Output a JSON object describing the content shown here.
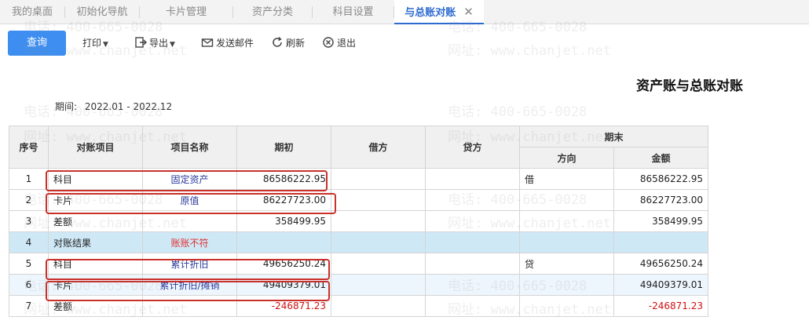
{
  "tabs": [
    {
      "label": "我的桌面"
    },
    {
      "label": "初始化导航"
    },
    {
      "label": "卡片管理"
    },
    {
      "label": "资产分类"
    },
    {
      "label": "科目设置"
    },
    {
      "label": "与总账对账"
    }
  ],
  "toolbar": {
    "query": "查询",
    "print": "打印",
    "export": "导出",
    "email": "发送邮件",
    "refresh": "刷新",
    "exit": "退出"
  },
  "report": {
    "title": "资产账与总账对账",
    "period_label": "期间:",
    "period_value": "2022.01 - 2022.12"
  },
  "table": {
    "headers": {
      "seq": "序号",
      "item": "对账项目",
      "name": "项目名称",
      "opening": "期初",
      "debit": "借方",
      "credit": "贷方",
      "ending": "期末",
      "direction": "方向",
      "amount": "金额"
    },
    "rows": [
      {
        "seq": "1",
        "item": "科目",
        "name": "固定资产",
        "opening": "86586222.95",
        "debit": "",
        "credit": "",
        "direction": "借",
        "amount": "86586222.95"
      },
      {
        "seq": "2",
        "item": "卡片",
        "name": "原值",
        "opening": "86227723.00",
        "debit": "",
        "credit": "",
        "direction": "",
        "amount": "86227723.00"
      },
      {
        "seq": "3",
        "item": "差额",
        "name": "",
        "opening": "358499.95",
        "debit": "",
        "credit": "",
        "direction": "",
        "amount": "358499.95"
      },
      {
        "seq": "4",
        "item": "对账结果",
        "name": "账账不符",
        "opening": "",
        "debit": "",
        "credit": "",
        "direction": "",
        "amount": ""
      },
      {
        "seq": "5",
        "item": "科目",
        "name": "累计折旧",
        "opening": "49656250.24",
        "debit": "",
        "credit": "",
        "direction": "贷",
        "amount": "49656250.24"
      },
      {
        "seq": "6",
        "item": "卡片",
        "name": "累计折旧/摊销",
        "opening": "49409379.01",
        "debit": "",
        "credit": "",
        "direction": "",
        "amount": "49409379.01"
      },
      {
        "seq": "7",
        "item": "差额",
        "name": "",
        "opening": "-246871.23",
        "debit": "",
        "credit": "",
        "direction": "",
        "amount": "-246871.23"
      }
    ]
  },
  "watermark": {
    "phone": "电话: 400-665-0028",
    "site": "网址: www.chanjet.net"
  },
  "colors": {
    "accent": "#3d8ef0",
    "active_tab": "#2d6bd0",
    "highlight_row": "#cfe8f6",
    "negative": "#d01010",
    "callout": "#c9312b"
  }
}
